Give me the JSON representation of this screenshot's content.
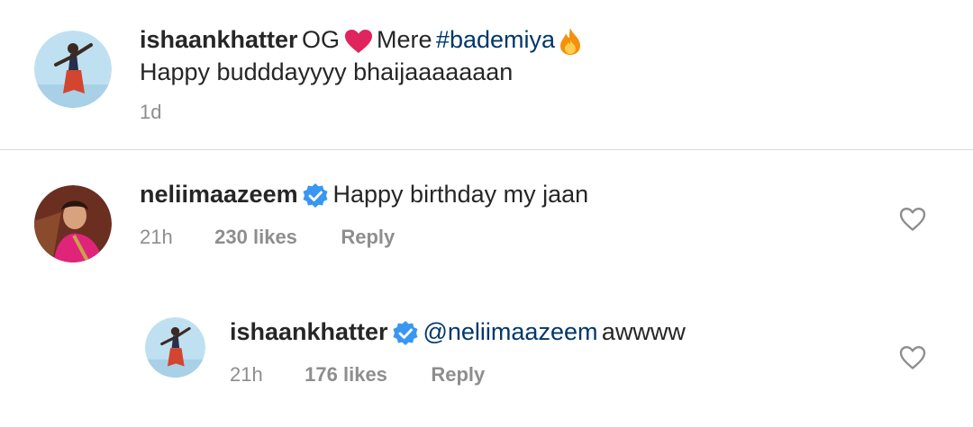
{
  "caption": {
    "username": "ishaankhatter",
    "text_before": "OG",
    "text_mid": "Mere",
    "hashtag": "#bademiya",
    "line2": "Happy budddayyyy bhaijaaaaaaan",
    "time": "1d"
  },
  "comments": [
    {
      "username": "neliimaazeem",
      "verified": true,
      "text": "Happy birthday my jaan",
      "time": "21h",
      "likes": "230 likes",
      "reply_label": "Reply"
    }
  ],
  "replies": [
    {
      "username": "ishaankhatter",
      "verified": true,
      "mention": "@neliimaazeem",
      "text": "awwww",
      "time": "21h",
      "likes": "176 likes",
      "reply_label": "Reply"
    }
  ],
  "colors": {
    "verified": "#3897f0",
    "mention": "#00376b",
    "heart_emoji": "#e0245e",
    "meta": "#8e8e8e"
  },
  "icons": {
    "heart_emoji": "heart-emoji-icon",
    "fire_emoji": "fire-emoji-icon",
    "verified": "verified-badge-icon",
    "like": "heart-outline-icon"
  }
}
